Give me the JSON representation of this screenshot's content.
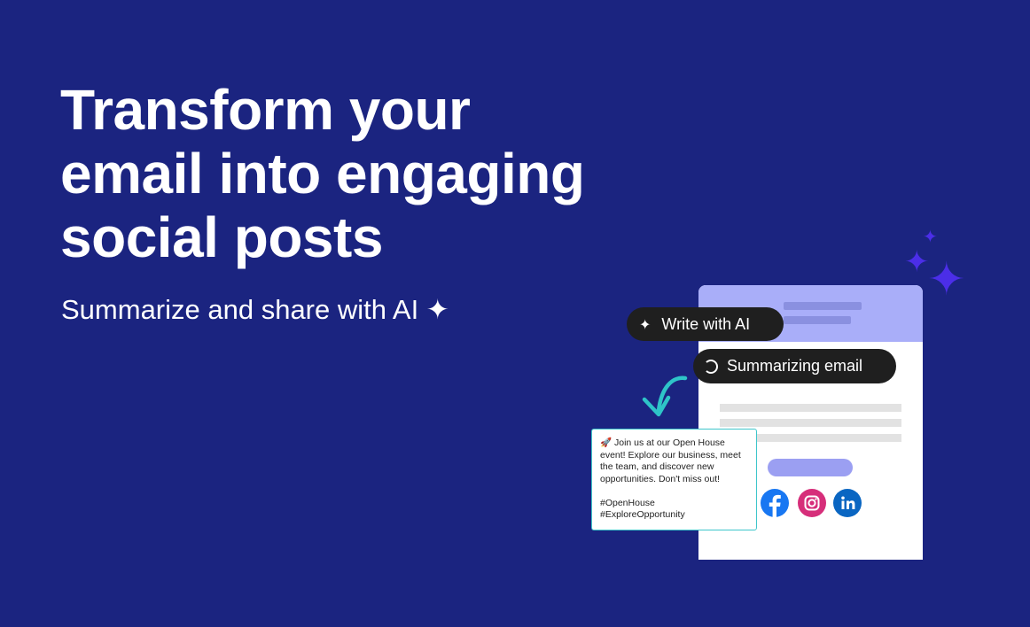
{
  "hero": {
    "title_lines": [
      "Transform your",
      "email into engaging",
      "social posts"
    ],
    "subtitle": "Summarize and share with AI ✦"
  },
  "pills": {
    "write_label": "Write with AI",
    "write_glyph": "✦",
    "summary_label": "Summarizing email"
  },
  "post": {
    "body": "🚀 Join us at our Open House event!  Explore our business, meet the team, and discover new opportunities. Don't miss out!",
    "tags": [
      "#OpenHouse",
      "#ExploreOpportunity"
    ]
  },
  "social": [
    "facebook-icon",
    "instagram-icon",
    "linkedin-icon"
  ],
  "colors": {
    "background": "#1b2480",
    "email_header": "#a9aef9",
    "sparkle": "#4b2ee8",
    "pill": "#1f1f1f",
    "arrow": "#2ec4c8",
    "facebook": "#1877f2",
    "instagram": "#d62e7a",
    "linkedin": "#0a66c2"
  }
}
